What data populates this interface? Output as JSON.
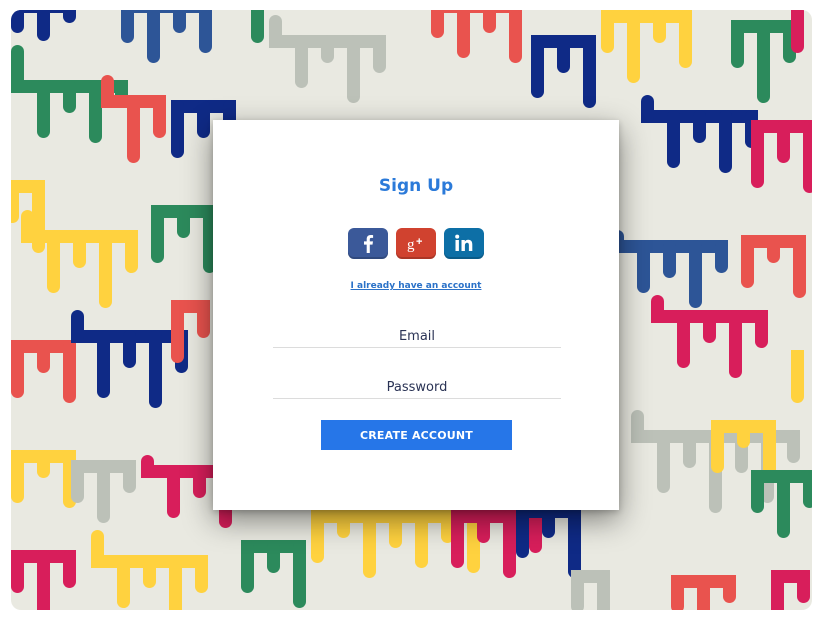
{
  "signup": {
    "title": "Sign Up",
    "already_have_account_link": "I already have an account",
    "email_placeholder": "Email",
    "email_value": "",
    "password_placeholder": "Password",
    "password_value": "",
    "create_account_label": "CREATE ACCOUNT"
  },
  "social_buttons": [
    {
      "icon": "facebook-icon",
      "glyph": "f",
      "color": "#3b5999"
    },
    {
      "icon": "google-plus-icon",
      "glyph": "g+",
      "color": "#d0422f"
    },
    {
      "icon": "linkedin-icon",
      "glyph": "in",
      "color": "#0d6fa6"
    }
  ],
  "colors": {
    "accent": "#2b7ad9",
    "button": "#2676e8",
    "background": "#e9e9e1",
    "pattern": [
      "#2c8a5c",
      "#e9534e",
      "#0f2a86",
      "#ffd23f",
      "#bcc1b8",
      "#d81e5b",
      "#2d5597"
    ]
  }
}
